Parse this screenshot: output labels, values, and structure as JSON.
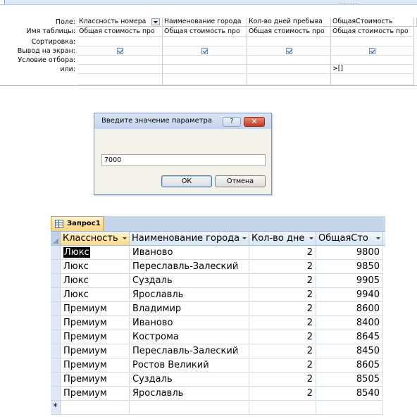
{
  "design_grid": {
    "row_labels": {
      "field": "Поле:",
      "table": "Имя таблицы:",
      "sort": "Сортировка:",
      "show": "Вывод на экран:",
      "criteria": "Условие отбора:",
      "or": "или:"
    },
    "columns": [
      {
        "field": "Классность номера",
        "table": "Общая стоимость про",
        "show": true,
        "criteria": "",
        "or": ""
      },
      {
        "field": "Наименование города",
        "table": "Общая стоимость про",
        "show": true,
        "criteria": "",
        "or": ""
      },
      {
        "field": "Кол-во дней пребыва",
        "table": "Общая стоимость про",
        "show": true,
        "criteria": "",
        "or": ""
      },
      {
        "field": "ОбщаяСтоимость",
        "table": "Общая стоимость про",
        "show": true,
        "criteria": "",
        "or": ">[]"
      }
    ]
  },
  "dialog": {
    "title": "Введите значение параметра",
    "help_label": "?",
    "close_label": "✕",
    "input_value": "7000",
    "ok_label": "ОК",
    "cancel_label": "Отмена"
  },
  "datasheet": {
    "tab_label": "Запрос1",
    "headers": [
      "Классность",
      "Наименование города",
      "Кол-во дне",
      "ОбщаяСто"
    ],
    "rows": [
      [
        "Люкс",
        "Иваново",
        "2",
        "9800"
      ],
      [
        "Люкс",
        "Переславль-Залеский",
        "2",
        "9850"
      ],
      [
        "Люкс",
        "Суздаль",
        "2",
        "9905"
      ],
      [
        "Люкс",
        "Ярославль",
        "2",
        "9940"
      ],
      [
        "Премиум",
        "Владимир",
        "2",
        "8600"
      ],
      [
        "Премиум",
        "Иваново",
        "2",
        "8400"
      ],
      [
        "Премиум",
        "Кострома",
        "2",
        "8645"
      ],
      [
        "Премиум",
        "Переславль-Залеский",
        "2",
        "8450"
      ],
      [
        "Премиум",
        "Ростов Великий",
        "2",
        "8605"
      ],
      [
        "Премиум",
        "Суздаль",
        "2",
        "8505"
      ],
      [
        "Премиум",
        "Ярославль",
        "2",
        "8540"
      ]
    ],
    "new_row_marker": "*"
  }
}
